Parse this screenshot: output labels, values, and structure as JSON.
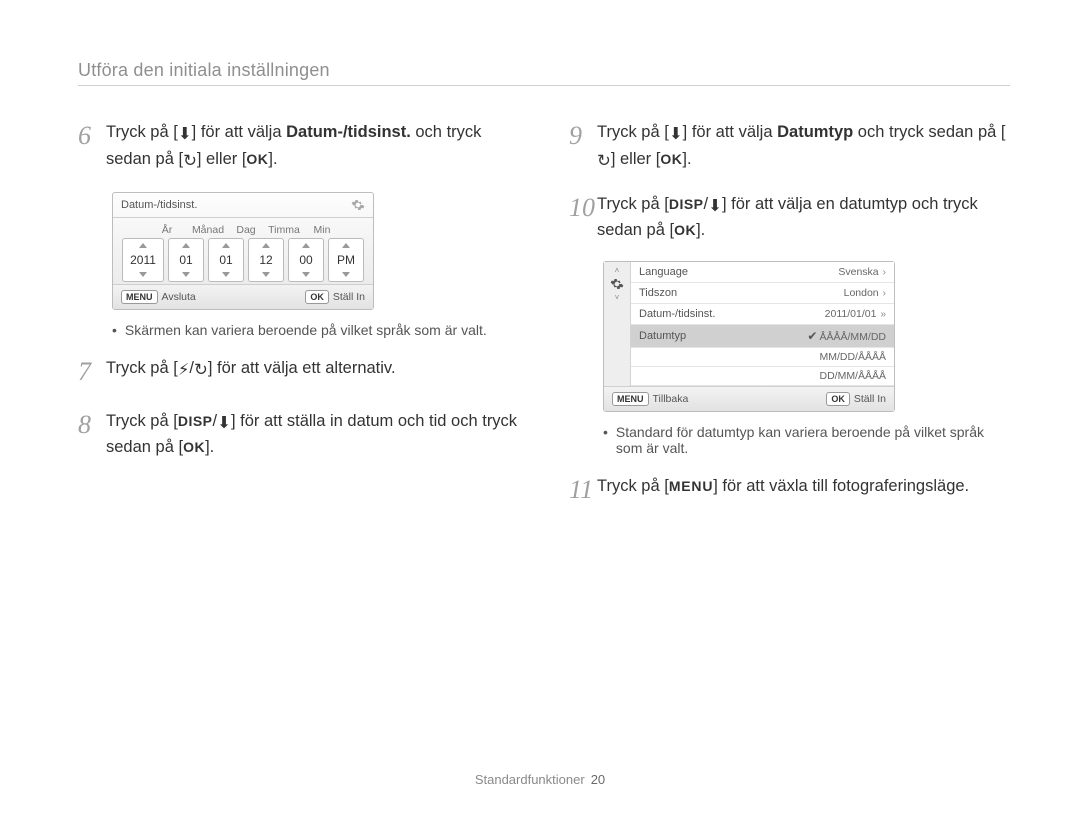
{
  "header": "Utföra den initiala inställningen",
  "footer": {
    "section": "Standardfunktioner",
    "page": "20"
  },
  "icons": {
    "down": "⬇",
    "timer": "↻",
    "flash": "⚡",
    "ok": "OK",
    "disp": "DISP",
    "menu": "MENU"
  },
  "left": {
    "s6_a": "Tryck på [",
    "s6_b": "] för att välja ",
    "s6_bold": "Datum-/tidsinst.",
    "s6_c": " och tryck sedan på [",
    "s6_d": "] eller [",
    "s6_e": "].",
    "s7_a": "Tryck på [",
    "s7_b": "/",
    "s7_c": "] för att välja ett alternativ.",
    "s8_a": "Tryck på [",
    "s8_b": "/",
    "s8_c": "] för att ställa in datum och tid och tryck sedan på [",
    "s8_d": "].",
    "note": "Skärmen kan variera beroende på vilket språk som är valt."
  },
  "ui1": {
    "title": "Datum-/tidsinst.",
    "cols": [
      "År",
      "Månad",
      "Dag",
      "Timma",
      "Min",
      ""
    ],
    "vals": [
      "2011",
      "01",
      "01",
      "12",
      "00",
      "PM"
    ],
    "left_key": "MENU",
    "left_label": "Avsluta",
    "right_key": "OK",
    "right_label": "Ställ In"
  },
  "right": {
    "s9_a": "Tryck på [",
    "s9_b": "] för att välja ",
    "s9_bold": "Datumtyp",
    "s9_c": " och tryck sedan på [",
    "s9_d": "] eller [",
    "s9_e": "].",
    "s10_a": "Tryck på [",
    "s10_b": "/",
    "s10_c": "] för att välja en datumtyp och tryck sedan på  [",
    "s10_d": "].",
    "note": "Standard för datumtyp kan variera beroende på vilket språk som är valt.",
    "s11_a": "Tryck på [",
    "s11_b": "] för att växla till fotograferingsläge."
  },
  "ui2": {
    "rows": [
      {
        "label": "Language",
        "value": "Svenska",
        "car": "›"
      },
      {
        "label": "Tidszon",
        "value": "London",
        "car": "›"
      },
      {
        "label": "Datum-/tidsinst.",
        "value": "2011/01/01",
        "car": "»"
      }
    ],
    "sel": {
      "label": "Datumtyp",
      "value": "ÅÅÅÅ/MM/DD"
    },
    "subs": [
      "MM/DD/ÅÅÅÅ",
      "DD/MM/ÅÅÅÅ"
    ],
    "left_key": "MENU",
    "left_label": "Tillbaka",
    "right_key": "OK",
    "right_label": "Ställ In"
  },
  "nums": {
    "6": "6",
    "7": "7",
    "8": "8",
    "9": "9",
    "10": "10",
    "11": "11"
  }
}
